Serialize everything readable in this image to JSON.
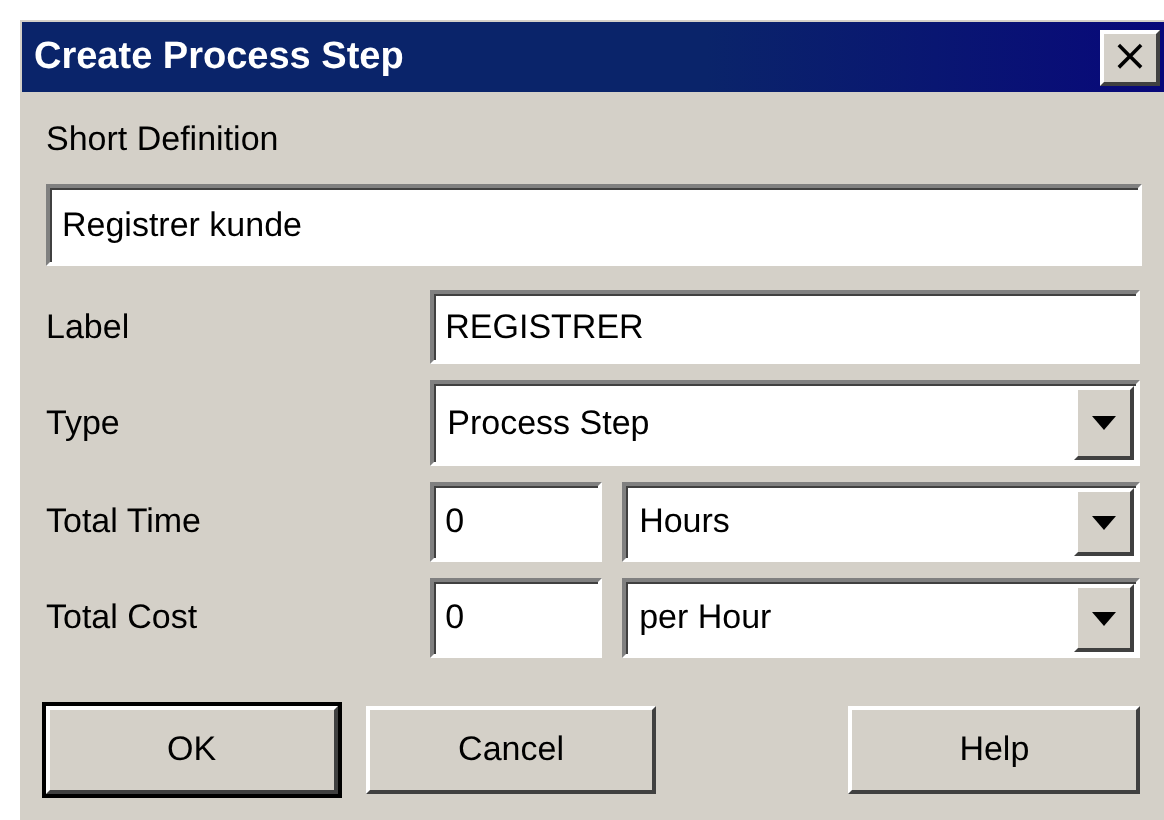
{
  "window": {
    "title": "Create Process Step",
    "close": "×"
  },
  "short_definition": {
    "label": "Short Definition",
    "value": "Registrer kunde"
  },
  "fields": [
    {
      "kind": "text",
      "label": "Label",
      "value": "REGISTRER"
    },
    {
      "kind": "select",
      "label": "Type",
      "value": "Process Step"
    },
    {
      "kind": "amount",
      "label": "Total Time",
      "value": "0",
      "unit": "Hours"
    },
    {
      "kind": "amount",
      "label": "Total Cost",
      "value": "0",
      "unit": "per Hour"
    }
  ],
  "buttons": [
    {
      "label": "OK",
      "default": true
    },
    {
      "label": "Cancel",
      "default": false
    },
    {
      "label": "Help",
      "default": false
    }
  ]
}
